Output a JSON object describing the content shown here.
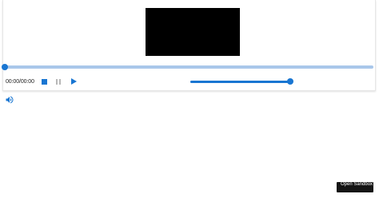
{
  "player": {
    "time_display": "00:00/00:00",
    "progress_fraction": 0,
    "volume_fraction": 1.0
  },
  "controls": {
    "stop_icon": "stop-icon",
    "pause_icon": "pause-icon",
    "play_icon": "play-icon",
    "volume_icon": "volume-up-icon"
  },
  "colors": {
    "accent": "#1976d2",
    "track": "#a9c7ea",
    "disabled": "#b8b8b8",
    "video_background": "#000000"
  },
  "sandbox_button": {
    "label": "Open Sandbox"
  }
}
